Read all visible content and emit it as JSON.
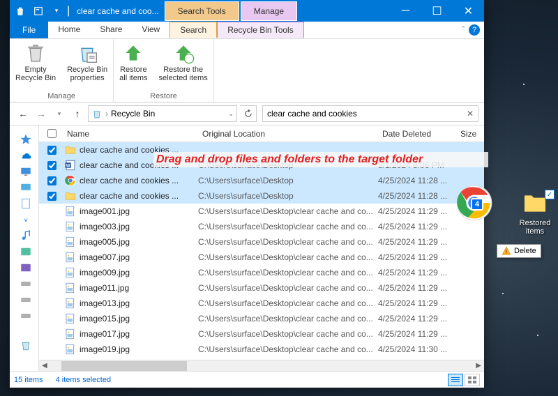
{
  "title": "clear cache and coo...",
  "context_tabs": {
    "search": "Search Tools",
    "manage": "Manage"
  },
  "menu": {
    "file": "File",
    "home": "Home",
    "share": "Share",
    "view": "View",
    "search": "Search",
    "recycle": "Recycle Bin Tools"
  },
  "ribbon": {
    "empty": "Empty\nRecycle Bin",
    "props": "Recycle Bin\nproperties",
    "manage_group": "Manage",
    "restore_all": "Restore\nall items",
    "restore_sel": "Restore the\nselected items",
    "restore_group": "Restore"
  },
  "address": {
    "location": "Recycle Bin"
  },
  "search": {
    "value": "clear cache and cookies"
  },
  "columns": {
    "name": "Name",
    "loc": "Original Location",
    "date": "Date Deleted",
    "size": "Size"
  },
  "rows": [
    {
      "sel": true,
      "icon": "folder",
      "name": "clear cache and cookies ...",
      "loc": "",
      "date": ""
    },
    {
      "sel": true,
      "icon": "word",
      "name": "clear cache and cookies ...",
      "loc": "C:\\Users\\surface\\Desktop",
      "date": "5/1/2024 8:06 PM"
    },
    {
      "sel": true,
      "icon": "chrome",
      "name": "clear cache and cookies ...",
      "loc": "C:\\Users\\surface\\Desktop",
      "date": "4/25/2024 11:28 ..."
    },
    {
      "sel": true,
      "icon": "folder",
      "name": "clear cache and cookies ...",
      "loc": "C:\\Users\\surface\\Desktop",
      "date": "4/25/2024 11:28 ..."
    },
    {
      "sel": false,
      "icon": "image",
      "name": "image001.jpg",
      "loc": "C:\\Users\\surface\\Desktop\\clear cache and co...",
      "date": "4/25/2024 11:29 ..."
    },
    {
      "sel": false,
      "icon": "image",
      "name": "image003.jpg",
      "loc": "C:\\Users\\surface\\Desktop\\clear cache and co...",
      "date": "4/25/2024 11:29 ..."
    },
    {
      "sel": false,
      "icon": "image",
      "name": "image005.jpg",
      "loc": "C:\\Users\\surface\\Desktop\\clear cache and co...",
      "date": "4/25/2024 11:29 ..."
    },
    {
      "sel": false,
      "icon": "image",
      "name": "image007.jpg",
      "loc": "C:\\Users\\surface\\Desktop\\clear cache and co...",
      "date": "4/25/2024 11:29 ..."
    },
    {
      "sel": false,
      "icon": "image",
      "name": "image009.jpg",
      "loc": "C:\\Users\\surface\\Desktop\\clear cache and co...",
      "date": "4/25/2024 11:29 ..."
    },
    {
      "sel": false,
      "icon": "image",
      "name": "image011.jpg",
      "loc": "C:\\Users\\surface\\Desktop\\clear cache and co...",
      "date": "4/25/2024 11:29 ..."
    },
    {
      "sel": false,
      "icon": "image",
      "name": "image013.jpg",
      "loc": "C:\\Users\\surface\\Desktop\\clear cache and co...",
      "date": "4/25/2024 11:29 ..."
    },
    {
      "sel": false,
      "icon": "image",
      "name": "image015.jpg",
      "loc": "C:\\Users\\surface\\Desktop\\clear cache and co...",
      "date": "4/25/2024 11:29 ..."
    },
    {
      "sel": false,
      "icon": "image",
      "name": "image017.jpg",
      "loc": "C:\\Users\\surface\\Desktop\\clear cache and co...",
      "date": "4/25/2024 11:29 ..."
    },
    {
      "sel": false,
      "icon": "image",
      "name": "image019.jpg",
      "loc": "C:\\Users\\surface\\Desktop\\clear cache and co...",
      "date": "4/25/2024 11:30 ..."
    }
  ],
  "status": {
    "count": "15 items",
    "selected": "4 items selected"
  },
  "annotation": "Drag and drop files and folders to the target folder",
  "desktop": {
    "restored": "Restored\nitems"
  },
  "drag": {
    "count": "4"
  },
  "tooltip": {
    "delete": "Delete"
  }
}
